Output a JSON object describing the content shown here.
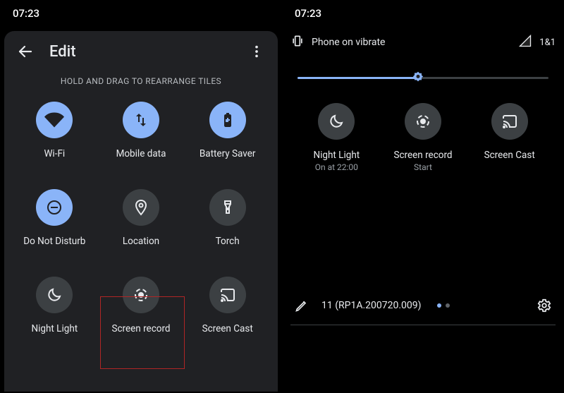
{
  "status_time": "07:23",
  "left": {
    "title": "Edit",
    "hint": "HOLD AND DRAG TO REARRANGE TILES",
    "tiles": [
      {
        "label": "Wi-Fi"
      },
      {
        "label": "Mobile data"
      },
      {
        "label": "Battery Saver"
      },
      {
        "label": "Do Not Disturb"
      },
      {
        "label": "Location"
      },
      {
        "label": "Torch"
      },
      {
        "label": "Night Light"
      },
      {
        "label": "Screen record"
      },
      {
        "label": "Screen Cast"
      }
    ]
  },
  "right": {
    "ringer_text": "Phone on vibrate",
    "signal_text": "1&1",
    "tiles": [
      {
        "label": "Night Light",
        "sub": "On at 22:00"
      },
      {
        "label": "Screen record",
        "sub": "Start"
      },
      {
        "label": "Screen Cast",
        "sub": ""
      }
    ],
    "build": "11 (RP1A.200720.009)"
  }
}
